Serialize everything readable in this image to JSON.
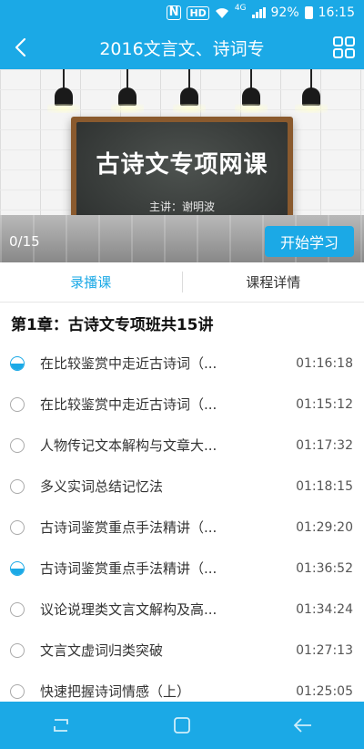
{
  "status_bar": {
    "nfc": "N",
    "hd": "HD",
    "network": "4G",
    "battery": "92%",
    "time": "16:15"
  },
  "header": {
    "title": "2016文言文、诗词专",
    "back_icon": "chevron-left-icon",
    "menu_icon": "grid-icon"
  },
  "banner": {
    "board_title": "古诗文专项网课",
    "board_subtitle": "主讲：谢明波",
    "progress": "0/15",
    "start_button": "开始学习"
  },
  "tabs": [
    {
      "label": "录播课",
      "active": true
    },
    {
      "label": "课程详情",
      "active": false
    }
  ],
  "chapter": {
    "title": "第1章：古诗文专项班共15讲"
  },
  "lessons": [
    {
      "title": "在比较鉴赏中走近古诗词（...",
      "duration": "01:16:18",
      "status": "partial"
    },
    {
      "title": "在比较鉴赏中走近古诗词（...",
      "duration": "01:15:12",
      "status": "none"
    },
    {
      "title": "人物传记文本解构与文章大...",
      "duration": "01:17:32",
      "status": "none"
    },
    {
      "title": "多义实词总结记忆法",
      "duration": "01:18:15",
      "status": "none"
    },
    {
      "title": " 古诗词鉴赏重点手法精讲（...",
      "duration": "01:29:20",
      "status": "none"
    },
    {
      "title": "古诗词鉴赏重点手法精讲（...",
      "duration": "01:36:52",
      "status": "partial"
    },
    {
      "title": "议论说理类文言文解构及高...",
      "duration": "01:34:24",
      "status": "none"
    },
    {
      "title": " 文言文虚词归类突破",
      "duration": "01:27:13",
      "status": "none"
    },
    {
      "title": "快速把握诗词情感（上）",
      "duration": "01:25:05",
      "status": "none"
    }
  ],
  "colors": {
    "accent": "#1ba9e6",
    "text": "#333333",
    "board": "#2b2e2d",
    "board_frame": "#8a5a2e"
  },
  "navbar": {
    "icons": [
      "recent-apps-icon",
      "home-icon",
      "back-arrow-icon"
    ]
  }
}
